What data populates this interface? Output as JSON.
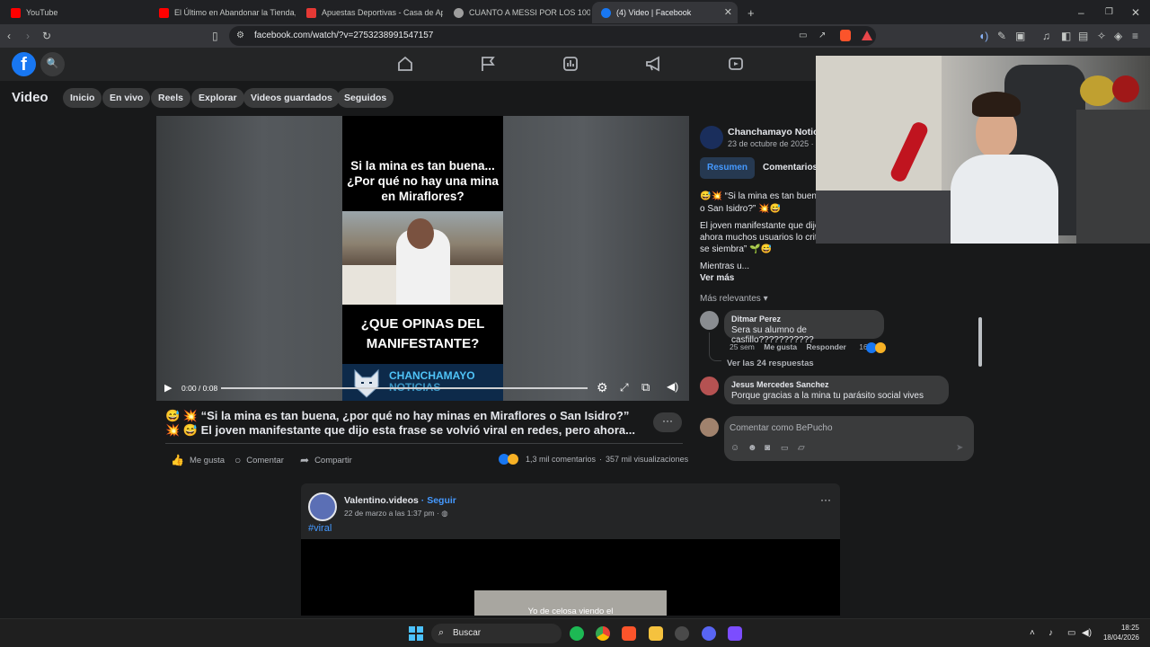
{
  "browser": {
    "tabs": [
      {
        "title": "YouTube",
        "favicon_color": "#ff0000"
      },
      {
        "title": "El Último en Abandonar la Tienda, Ga",
        "favicon_color": "#ff0000"
      },
      {
        "title": "Apuestas Deportivas - Casa de Apue",
        "favicon_color": "#e53935"
      },
      {
        "title": "CUANTO A MESSI POR LOS 1000 - B",
        "favicon_color": "#9e9e9e"
      },
      {
        "title": "(4) Video | Facebook",
        "favicon_color": "#1877f2",
        "active": true
      }
    ],
    "new_tab": "+",
    "url": "facebook.com/watch/?v=2753238991547157"
  },
  "facebook": {
    "logo": "f",
    "nav_icons": [
      "home-icon",
      "flag-icon",
      "chart-icon",
      "megaphone-icon",
      "video-icon"
    ],
    "page_title": "Video",
    "subnav": [
      "Inicio",
      "En vivo",
      "Reels",
      "Explorar",
      "Videos guardados",
      "Seguidos"
    ]
  },
  "video": {
    "overlay_top": "Si la mina es tan buena... ¿Por qué no hay una mina en Miraflores?",
    "overlay_bottom": "¿QUE OPINAS DEL MANIFESTANTE?",
    "brand_line1": "CHANCHAMAYO",
    "brand_line2": "NOTICIAS",
    "time": "0:00 / 0:08",
    "progress": 0.0
  },
  "post": {
    "caption_line1": "😅 💥 “Si la mina es tan buena, ¿por qué no hay minas en Miraflores o San Isidro?”",
    "caption_line2": "💥 😅 El joven manifestante que dijo esta frase se volvió viral en redes, pero ahora...",
    "more": "···",
    "like": "Me gusta",
    "comment": "Comentar",
    "share": "Compartir",
    "comments_count": "1,3 mil comentarios",
    "views_count": "357 mil visualizaciones"
  },
  "sidebar": {
    "page_name": "Chanchamayo Noticia",
    "date": "23 de octubre de 2025 ·",
    "tab_summary": "Resumen",
    "tab_comments": "Comentarios",
    "desc_line1": "😅💥 “Si la mina es tan buena",
    "desc_line2": "o San Isidro?” 💥😅",
    "desc_line3": "El joven manifestante que dijo",
    "desc_line4": "ahora muchos usuarios lo crit",
    "desc_line5": "se siembra” 🌱😅",
    "desc_line6": "Mientras u...",
    "see_more": "Ver más",
    "sort": "Más relevantes",
    "comments": [
      {
        "author": "Ditmar Perez",
        "text": "Sera su alumno de casfillo???????????",
        "age": "25 sem",
        "like": "Me gusta",
        "reply": "Responder",
        "reactions": "160"
      },
      {
        "author": "Jesus Mercedes Sanchez",
        "text": "Porque gracias a la mina tu parásito social vives"
      }
    ],
    "replies_link": "Ver las 24 respuestas",
    "comment_placeholder": "Comentar como BePucho"
  },
  "post2": {
    "author": "Valentino.videos",
    "follow": "· Seguir",
    "date": "22 de marzo a las 1:37 pm ·",
    "hashtag": "#viral",
    "subtitle": "Yo de celosa viendo el"
  },
  "taskbar": {
    "search_placeholder": "Buscar",
    "time": "18:25",
    "date": "18/04/2026"
  }
}
